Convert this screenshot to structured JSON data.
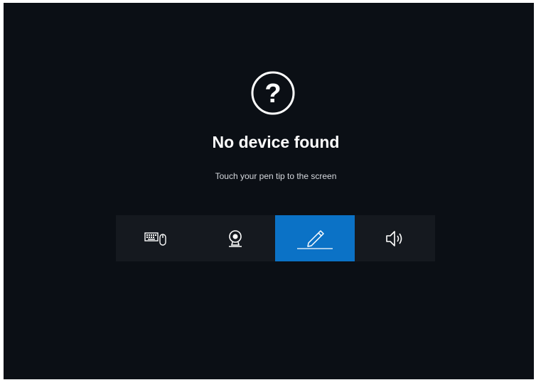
{
  "main": {
    "icon": "question-circle-icon",
    "title": "No device found",
    "hint": "Touch your pen tip to the screen"
  },
  "device_tabs": [
    {
      "id": "keyboard-mouse",
      "icon": "keyboard-mouse-icon",
      "active": false
    },
    {
      "id": "webcam",
      "icon": "webcam-icon",
      "active": false
    },
    {
      "id": "pen",
      "icon": "pen-icon",
      "active": true
    },
    {
      "id": "speaker",
      "icon": "speaker-icon",
      "active": false
    }
  ],
  "colors": {
    "background": "#0b0f15",
    "bar": "#15191f",
    "accent": "#0b72c6",
    "text": "#ffffff"
  }
}
